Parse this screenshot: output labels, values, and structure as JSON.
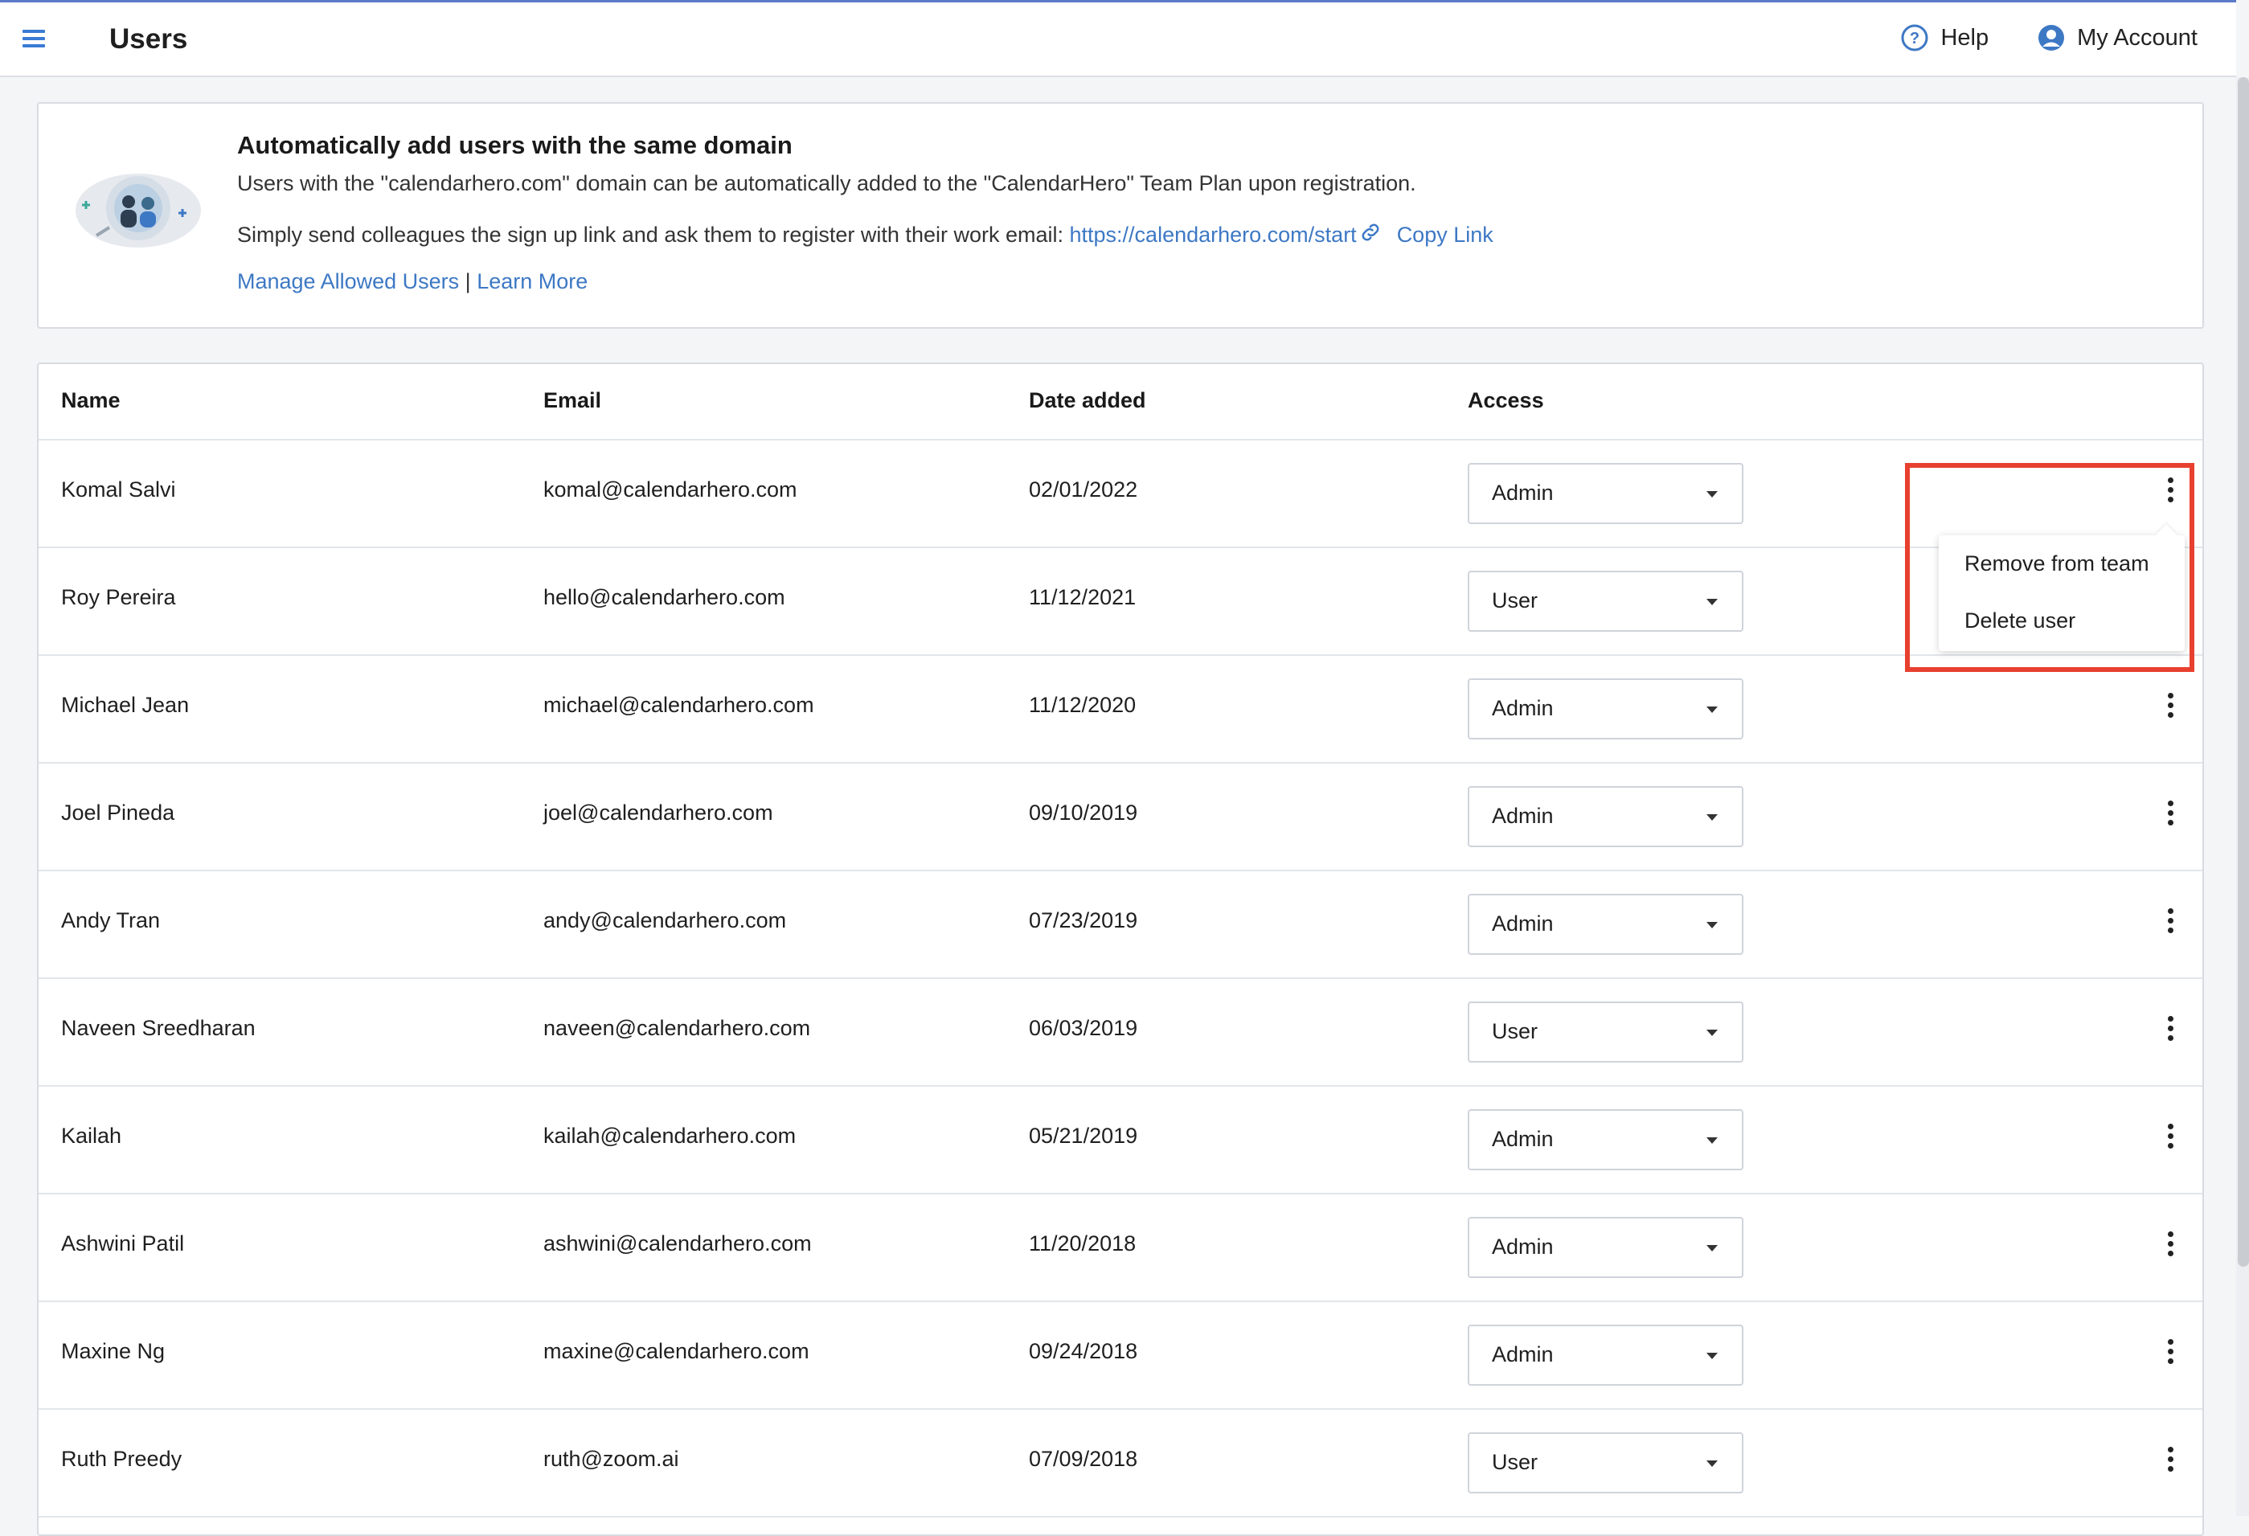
{
  "header": {
    "title": "Users",
    "help_label": "Help",
    "account_label": "My Account"
  },
  "banner": {
    "title": "Automatically add users with the same domain",
    "line1": "Users with the \"calendarhero.com\" domain can be automatically added to the \"CalendarHero\" Team Plan upon registration.",
    "line2_prefix": "Simply send colleagues the sign up link and ask them to register with their work email:",
    "signup_link": "https://calendarhero.com/start",
    "copy_link": "Copy Link",
    "manage_link": "Manage Allowed Users",
    "separator": "|",
    "learn_more": "Learn More"
  },
  "table": {
    "columns": [
      "Name",
      "Email",
      "Date added",
      "Access"
    ],
    "rows": [
      {
        "name": "Komal Salvi",
        "email": "komal@calendarhero.com",
        "date": "02/01/2022",
        "access": "Admin"
      },
      {
        "name": "Roy Pereira",
        "email": "hello@calendarhero.com",
        "date": "11/12/2021",
        "access": "User"
      },
      {
        "name": "Michael Jean",
        "email": "michael@calendarhero.com",
        "date": "11/12/2020",
        "access": "Admin"
      },
      {
        "name": "Joel Pineda",
        "email": "joel@calendarhero.com",
        "date": "09/10/2019",
        "access": "Admin"
      },
      {
        "name": "Andy Tran",
        "email": "andy@calendarhero.com",
        "date": "07/23/2019",
        "access": "Admin"
      },
      {
        "name": "Naveen Sreedharan",
        "email": "naveen@calendarhero.com",
        "date": "06/03/2019",
        "access": "User"
      },
      {
        "name": "Kailah",
        "email": "kailah@calendarhero.com",
        "date": "05/21/2019",
        "access": "Admin"
      },
      {
        "name": "Ashwini Patil",
        "email": "ashwini@calendarhero.com",
        "date": "11/20/2018",
        "access": "Admin"
      },
      {
        "name": "Maxine Ng",
        "email": "maxine@calendarhero.com",
        "date": "09/24/2018",
        "access": "Admin"
      },
      {
        "name": "Ruth Preedy",
        "email": "ruth@zoom.ai",
        "date": "07/09/2018",
        "access": "User"
      }
    ]
  },
  "row_menu": {
    "items": [
      "Remove from team",
      "Delete user"
    ]
  },
  "colors": {
    "accent": "#3d78c4",
    "highlight": "#e8402f"
  },
  "icons": [
    "menu-icon",
    "help-icon",
    "account-icon",
    "link-icon",
    "more-vertical-icon",
    "caret-down-icon"
  ]
}
